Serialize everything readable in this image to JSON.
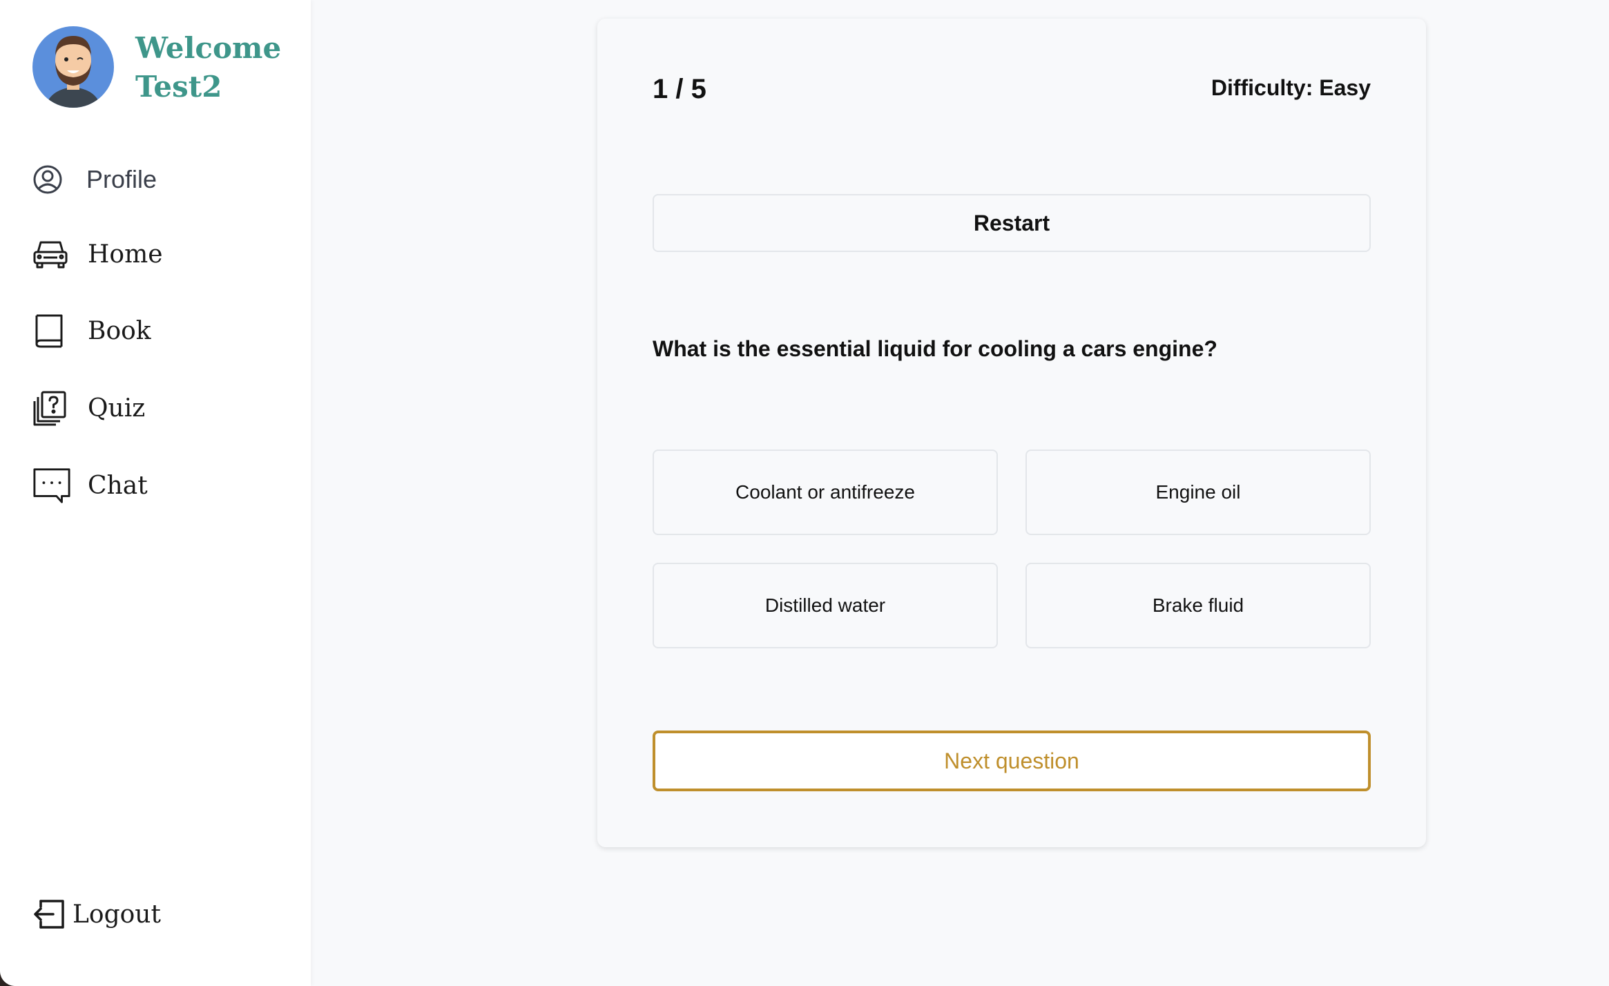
{
  "user": {
    "welcome_line1": "Welcome",
    "welcome_line2": "Test2"
  },
  "sidebar": {
    "items": [
      {
        "label": "Profile",
        "icon": "user-circle-icon"
      },
      {
        "label": "Home",
        "icon": "car-icon"
      },
      {
        "label": "Book",
        "icon": "book-icon"
      },
      {
        "label": "Quiz",
        "icon": "quiz-icon"
      },
      {
        "label": "Chat",
        "icon": "chat-icon"
      }
    ],
    "logout": {
      "label": "Logout",
      "icon": "logout-icon"
    }
  },
  "quiz": {
    "progress": "1 / 5",
    "difficulty": "Difficulty: Easy",
    "restart_label": "Restart",
    "question": "What is the essential liquid for cooling a cars engine?",
    "answers": [
      "Coolant or antifreeze",
      "Engine oil",
      "Distilled water",
      "Brake fluid"
    ],
    "next_label": "Next question"
  },
  "colors": {
    "brand_teal": "#3e968a",
    "accent_gold": "#bf8f2c",
    "background": "#f8f9fb"
  }
}
